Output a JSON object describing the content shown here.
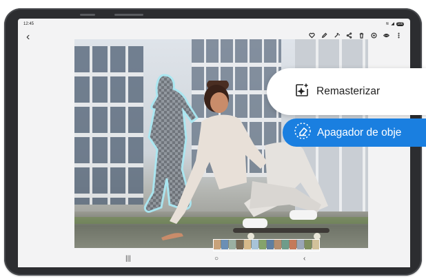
{
  "status": {
    "time": "12:45",
    "battery": "100"
  },
  "actions": {
    "remaster": "Remasterizar",
    "object_eraser": "Apagador de obje"
  },
  "toolbar_icons": [
    "heart-icon",
    "edit-icon",
    "effects-icon",
    "share-icon",
    "delete-icon",
    "remaster-icon",
    "eye-icon",
    "more-icon"
  ],
  "colors": {
    "accent": "#1a7fe0",
    "device": "#2c2d30",
    "screen": "#f3f3f4"
  },
  "thumbnail_colors": [
    "#c8a27a",
    "#6b8fb5",
    "#9bb0a2",
    "#7a6a55",
    "#d6b98a",
    "#a7c3d8",
    "#85a36b",
    "#5f7ea0",
    "#b48d6e",
    "#6f9c8a",
    "#c47a5a",
    "#9aa6b6",
    "#7f8f5e",
    "#d1c19a"
  ]
}
